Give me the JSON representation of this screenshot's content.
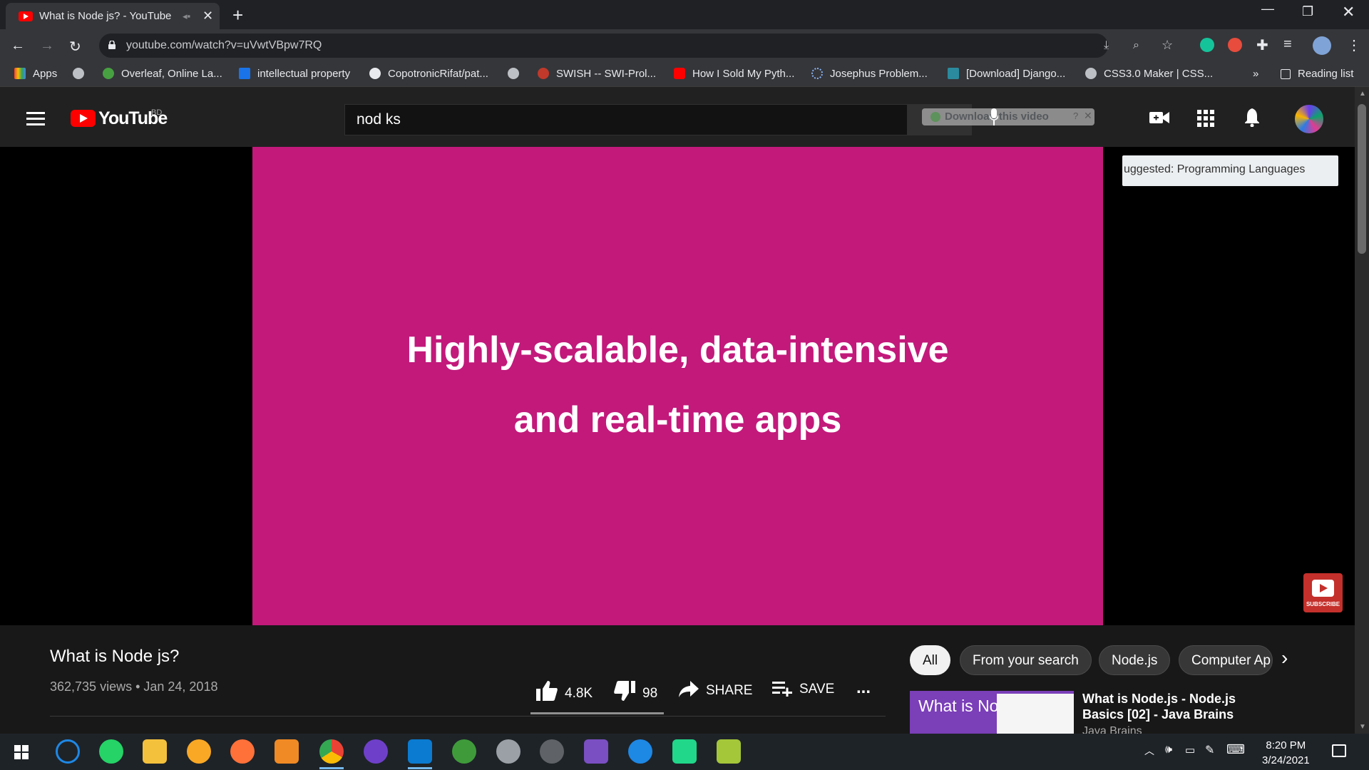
{
  "browser": {
    "tab_title": "What is Node js? - YouTube",
    "tab_close": "✕",
    "new_tab": "+",
    "url": "youtube.com/watch?v=uVwtVBpw7RQ",
    "bookmarks": [
      "Apps",
      "Overleaf, Online La...",
      "intellectual property",
      "CopotronicRifat/pat...",
      "SWISH -- SWI-Prol...",
      "How I Sold My Pyth...",
      "Josephus Problem...",
      "[Download] Django...",
      "CSS3.0 Maker | CSS..."
    ],
    "bookmarks_overflow": "»",
    "reading_list": "Reading list"
  },
  "youtube": {
    "logo_text": "YouTube",
    "country_code": "BD",
    "search_value": "nod ks",
    "download_banner": "Download this video",
    "download_help": "?",
    "download_close": "✕"
  },
  "video": {
    "line1": "Highly-scalable, data-intensive",
    "line2": "and real-time apps",
    "suggested_card": "uggested: Programming Languages",
    "subscribe_badge": "SUBSCRIBE"
  },
  "details": {
    "title": "What is Node js?",
    "meta": "362,735 views • Jan 24, 2018",
    "likes": "4.8K",
    "dislikes": "98",
    "share": "SHARE",
    "save": "SAVE",
    "more": "..."
  },
  "chips": [
    "All",
    "From your search",
    "Node.js",
    "Computer Ap"
  ],
  "related": {
    "thumb_text": "What is Node.js?",
    "title": "What is Node.js - Node.js Basics [02] - Java Brains",
    "channel": "Java Brains"
  },
  "taskbar": {
    "time": "8:20 PM",
    "date": "3/24/2021"
  },
  "colors": {
    "video_bg": "#c2197b",
    "yt_red": "#ff0000",
    "page_bg": "#181818"
  }
}
